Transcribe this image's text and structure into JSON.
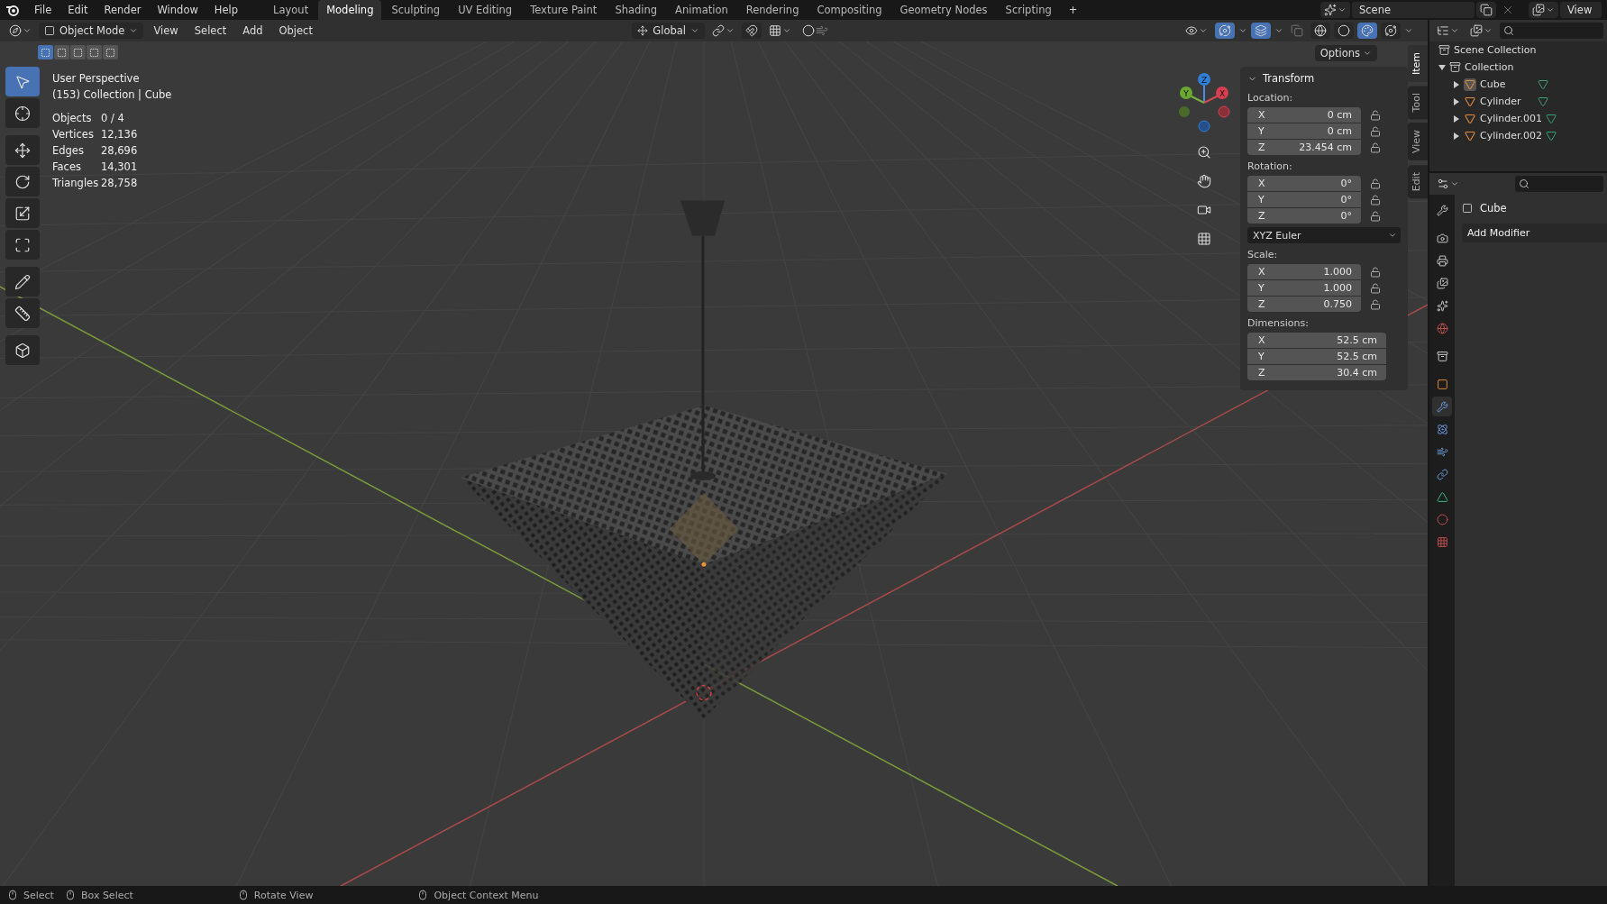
{
  "menus": [
    "File",
    "Edit",
    "Render",
    "Window",
    "Help"
  ],
  "workspaces": [
    {
      "label": "Layout",
      "selected": false
    },
    {
      "label": "Modeling",
      "selected": true
    },
    {
      "label": "Sculpting",
      "selected": false
    },
    {
      "label": "UV Editing",
      "selected": false
    },
    {
      "label": "Texture Paint",
      "selected": false
    },
    {
      "label": "Shading",
      "selected": false
    },
    {
      "label": "Animation",
      "selected": false
    },
    {
      "label": "Rendering",
      "selected": false
    },
    {
      "label": "Compositing",
      "selected": false
    },
    {
      "label": "Geometry Nodes",
      "selected": false
    },
    {
      "label": "Scripting",
      "selected": false
    }
  ],
  "add_workspace": "+",
  "scene": "Scene",
  "view_layer": "View",
  "viewport_header": {
    "mode": "Object Mode",
    "menus": [
      "View",
      "Select",
      "Add",
      "Object"
    ],
    "orientation": "Global",
    "options": "Options",
    "select_modes": [
      {
        "selected": true
      },
      {
        "selected": false
      },
      {
        "selected": false
      },
      {
        "selected": false
      },
      {
        "selected": false
      }
    ],
    "shading": [
      {
        "kind": "wireframe",
        "selected": false
      },
      {
        "kind": "solid",
        "selected": false
      },
      {
        "kind": "material",
        "selected": true
      },
      {
        "kind": "rendered",
        "selected": false
      }
    ]
  },
  "viewport_info": {
    "title": "User Perspective",
    "context": "(153) Collection | Cube",
    "stats": [
      {
        "label": "Objects",
        "value": "0 / 4"
      },
      {
        "label": "Vertices",
        "value": "12,136"
      },
      {
        "label": "Edges",
        "value": "28,696"
      },
      {
        "label": "Faces",
        "value": "14,301"
      },
      {
        "label": "Triangles",
        "value": "28,758"
      }
    ]
  },
  "tools": [
    {
      "kind": "select",
      "selected": true
    },
    {
      "kind": "cursor",
      "selected": false
    },
    {
      "kind": "move",
      "selected": false
    },
    {
      "kind": "rotate",
      "selected": false
    },
    {
      "kind": "scale",
      "selected": false
    },
    {
      "kind": "transform",
      "selected": false
    },
    {
      "kind": "annotate",
      "selected": false
    },
    {
      "kind": "measure",
      "selected": false
    },
    {
      "kind": "add_cube",
      "selected": false
    }
  ],
  "gizmo_axes": [
    "Z",
    "Y",
    "X"
  ],
  "transform": {
    "title": "Transform",
    "groups": [
      {
        "label": "Location:",
        "fields": [
          {
            "axis": "X",
            "value": "0 cm",
            "locked": false
          },
          {
            "axis": "Y",
            "value": "0 cm",
            "locked": false
          },
          {
            "axis": "Z",
            "value": "23.454 cm",
            "locked": false
          }
        ]
      },
      {
        "label": "Rotation:",
        "fields": [
          {
            "axis": "X",
            "value": "0°",
            "locked": false
          },
          {
            "axis": "Y",
            "value": "0°",
            "locked": false
          },
          {
            "axis": "Z",
            "value": "0°",
            "locked": false
          }
        ],
        "mode": "XYZ Euler"
      },
      {
        "label": "Scale:",
        "fields": [
          {
            "axis": "X",
            "value": "1.000",
            "locked": false
          },
          {
            "axis": "Y",
            "value": "1.000",
            "locked": false
          },
          {
            "axis": "Z",
            "value": "0.750",
            "locked": false
          }
        ]
      },
      {
        "label": "Dimensions:",
        "fields": [
          {
            "axis": "X",
            "value": "52.5 cm"
          },
          {
            "axis": "Y",
            "value": "52.5 cm"
          },
          {
            "axis": "Z",
            "value": "30.4 cm"
          }
        ]
      }
    ]
  },
  "sidebar_tabs": [
    {
      "label": "Item",
      "selected": true
    },
    {
      "label": "Tool",
      "selected": false
    },
    {
      "label": "View",
      "selected": false
    },
    {
      "label": "Edit",
      "selected": false
    }
  ],
  "outliner": {
    "root": "Scene Collection",
    "children": [
      {
        "label": "Collection",
        "expanded": true,
        "children": [
          {
            "label": "Cube",
            "active": true,
            "expanded": false
          },
          {
            "label": "Cylinder",
            "active": false,
            "expanded": false
          },
          {
            "label": "Cylinder.001",
            "active": false,
            "expanded": false
          },
          {
            "label": "Cylinder.002",
            "active": false,
            "expanded": false
          }
        ]
      }
    ]
  },
  "properties": {
    "object_name": "Cube",
    "add_modifier": "Add Modifier",
    "tabs": [
      {
        "kind": "tool",
        "selected": false
      },
      {
        "kind": "render",
        "selected": false
      },
      {
        "kind": "output",
        "selected": false
      },
      {
        "kind": "view_layer",
        "selected": false
      },
      {
        "kind": "scene",
        "selected": false
      },
      {
        "kind": "world",
        "selected": false
      },
      {
        "kind": "collection",
        "selected": false
      },
      {
        "kind": "object",
        "selected": false
      },
      {
        "kind": "modifiers",
        "selected": true
      },
      {
        "kind": "particles",
        "selected": false
      },
      {
        "kind": "physics",
        "selected": false
      },
      {
        "kind": "constraints",
        "selected": false
      },
      {
        "kind": "data",
        "selected": false
      },
      {
        "kind": "material",
        "selected": false
      },
      {
        "kind": "texture",
        "selected": false
      }
    ]
  },
  "status_bar": [
    "Select",
    "Box Select",
    "Rotate View",
    "Object Context Menu"
  ]
}
